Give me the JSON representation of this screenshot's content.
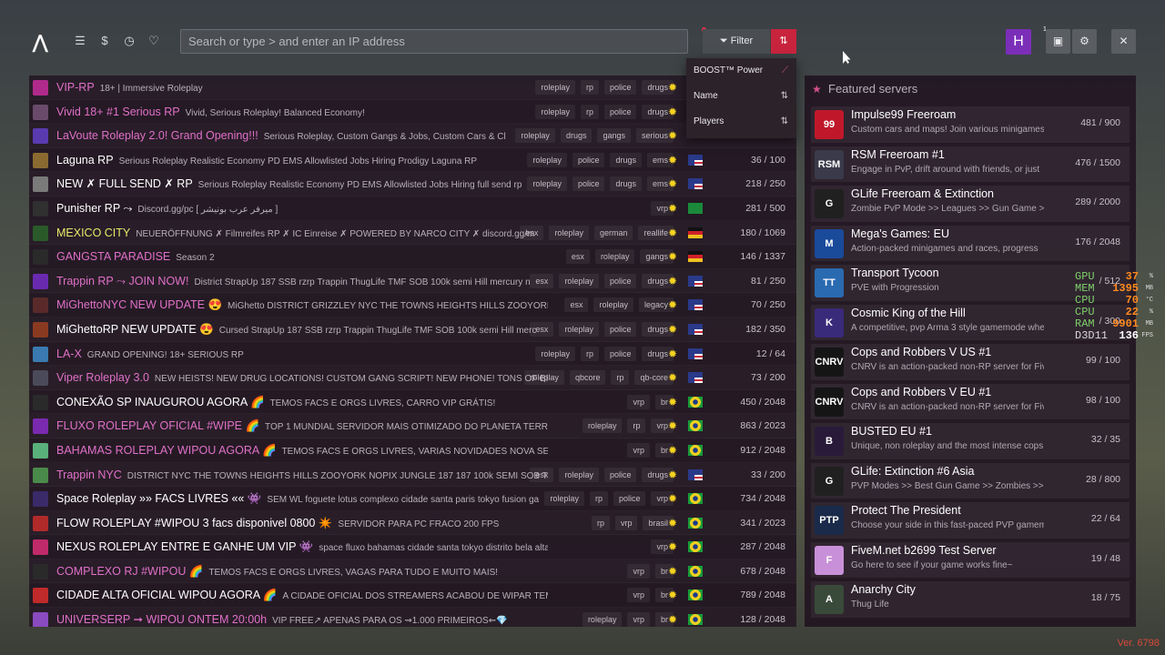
{
  "header": {
    "search_placeholder": "Search or type > and enter an IP address",
    "filter_label": "Filter",
    "avatar_letter": "H",
    "notif_count": "1"
  },
  "sort_menu": [
    {
      "label": "BOOST™ Power",
      "icon": "trend-icon"
    },
    {
      "label": "Name",
      "icon": "sort-az-icon"
    },
    {
      "label": "Players",
      "icon": "sort-num-icon"
    }
  ],
  "servers": [
    {
      "name": "VIP-RP",
      "color": "#e070c8",
      "desc": "18+ | Immersive Roleplay",
      "tags": [
        "roleplay",
        "rp",
        "police",
        "drugs"
      ],
      "flag": "",
      "players": "",
      "icon": "#b02a8c"
    },
    {
      "name": "Vivid 18+ #1 Serious RP",
      "color": "#e070c8",
      "desc": "Vivid, Serious Roleplay! Balanced Economy!",
      "tags": [
        "roleplay",
        "rp",
        "police",
        "drugs"
      ],
      "flag": "",
      "players": "",
      "icon": "#6a4a6a"
    },
    {
      "name": "LaVoute Roleplay 2.0! Grand Opening!!!",
      "color": "#e070c8",
      "desc": "Serious Roleplay, Custom Gangs & Jobs, Custom Cars & Cl",
      "tags": [
        "roleplay",
        "drugs",
        "gangs",
        "serious"
      ],
      "flag": "",
      "players": "",
      "icon": "#5a3ab0"
    },
    {
      "name": "Laguna RP",
      "color": "#ffffff",
      "desc": "Serious Roleplay Realistic Economy PD EMS Allowlisted Jobs Hiring Prodigy Laguna RP",
      "tags": [
        "roleplay",
        "police",
        "drugs",
        "ems"
      ],
      "flag": "us",
      "players": "36 / 100",
      "icon": "#8a6a30"
    },
    {
      "name": "NEW ✗ FULL SEND ✗ RP",
      "color": "#ffffff",
      "desc": "Serious Roleplay Realistic Economy PD EMS Allowlisted Jobs Hiring full send rp",
      "tags": [
        "roleplay",
        "police",
        "drugs",
        "ems"
      ],
      "flag": "us",
      "players": "218 / 250",
      "icon": "#7a7a7a"
    },
    {
      "name": "Punisher RP ⤳",
      "color": "#ffffff",
      "desc": "Discord.gg/pc [ ميرفر عرب بونيشر ]",
      "tags": [
        "vrp"
      ],
      "flag": "sa",
      "players": "281 / 500",
      "icon": "#303030"
    },
    {
      "name": "MEXICO CITY",
      "color": "#e8e86a",
      "desc": "NEUERÖFFNUNG ✗ Filmreifes RP ✗ IC Einreise ✗ POWERED BY NARCO CITY ✗ discord.gg/m",
      "tags": [
        "esx",
        "roleplay",
        "german",
        "reallife"
      ],
      "flag": "de",
      "players": "180 / 1069",
      "icon": "#2a5a2a"
    },
    {
      "name": "GANGSTA PARADISE",
      "color": "#e070c8",
      "desc": "Season 2",
      "tags": [
        "esx",
        "roleplay",
        "gangs"
      ],
      "flag": "de",
      "players": "146 / 1337",
      "icon": "#2a2a2a"
    },
    {
      "name": "Trappin RP ⤳ JOIN NOW!",
      "color": "#e070c8",
      "desc": "District StrapUp 187 SSB rzrp Trappin ThugLife TMF SOB 100k semi Hill mercury n",
      "tags": [
        "esx",
        "roleplay",
        "police",
        "drugs"
      ],
      "flag": "us",
      "players": "81 / 250",
      "icon": "#6a2ab0"
    },
    {
      "name": "MiGhettoNYC NEW UPDATE 😍",
      "color": "#e070c8",
      "desc": "MiGhetto DISTRICT GRIZZLEY NYC THE TOWNS HEIGHTS HILLS ZOOYORK NOPIX 3",
      "tags": [
        "esx",
        "roleplay",
        "legacy"
      ],
      "flag": "us",
      "players": "70 / 250",
      "icon": "#5a2a2a"
    },
    {
      "name": "MiGhettoRP NEW UPDATE 😍",
      "color": "#ffffff",
      "desc": "Cursed StrapUp 187 SSB rzrp Trappin ThugLife TMF SOB 100k semi Hill merc",
      "tags": [
        "esx",
        "roleplay",
        "police",
        "drugs"
      ],
      "flag": "us",
      "players": "182 / 350",
      "icon": "#8a3a20"
    },
    {
      "name": "LA-X",
      "color": "#e070c8",
      "desc": "GRAND OPENING! 18+ SERIOUS RP",
      "tags": [
        "roleplay",
        "rp",
        "police",
        "drugs"
      ],
      "flag": "us",
      "players": "12 / 64",
      "icon": "#3a7ab0"
    },
    {
      "name": "Viper Roleplay 3.0",
      "color": "#e070c8",
      "desc": "NEW HEISTS! NEW DRUG LOCATIONS! CUSTOM GANG SCRIPT! NEW PHONE! TONS OF BR",
      "tags": [
        "roleplay",
        "qbcore",
        "rp",
        "qb-core"
      ],
      "flag": "us",
      "players": "73 / 200",
      "icon": "#4a4a5a"
    },
    {
      "name": "CONEXÃO SP INAUGUROU AGORA 🌈",
      "color": "#ffffff",
      "desc": "TEMOS FACS E ORGS LIVRES, CARRO VIP GRÁTIS!",
      "tags": [
        "vrp",
        "br"
      ],
      "flag": "br",
      "players": "450 / 2048",
      "icon": "#2a2a2a"
    },
    {
      "name": "FLUXO ROLEPLAY OFICIAL #WIPE 🌈",
      "color": "#e070c8",
      "desc": "TOP 1 MUNDIAL SERVIDOR MAIS OTIMIZADO DO PLANETA TERRA",
      "tags": [
        "roleplay",
        "rp",
        "vrp"
      ],
      "flag": "br",
      "players": "863 / 2023",
      "icon": "#7a2ab0"
    },
    {
      "name": "BAHAMAS ROLEPLAY WIPOU AGORA 🌈",
      "color": "#e070c8",
      "desc": "TEMOS FACS E ORGS LIVRES, VARIAS NOVIDADES NOVA SEASON!",
      "tags": [
        "vrp",
        "br"
      ],
      "flag": "br",
      "players": "912 / 2048",
      "icon": "#5ab07a"
    },
    {
      "name": "Trappin NYC",
      "color": "#e070c8",
      "desc": "DISTRICT NYC THE TOWNS HEIGHTS HILLS ZOOYORK NOPIX JUNGLE 187 187 100k SEMI SOB TH",
      "tags": [
        "esx",
        "roleplay",
        "police",
        "drugs"
      ],
      "flag": "us",
      "players": "33 / 200",
      "icon": "#4a8a4a"
    },
    {
      "name": "Space Roleplay »» FACS LIVRES «« 👾",
      "color": "#ffffff",
      "desc": "SEM WL foguete lotus complexo cidade santa paris tokyo fusion ga",
      "tags": [
        "roleplay",
        "rp",
        "police",
        "vrp"
      ],
      "flag": "br",
      "players": "734 / 2048",
      "icon": "#3a2a6a"
    },
    {
      "name": "FLOW ROLEPLAY #WIPOU 3 facs disponivel 0800 ✴️",
      "color": "#ffffff",
      "desc": "SERVIDOR PARA PC FRACO 200 FPS",
      "tags": [
        "rp",
        "vrp",
        "brasil"
      ],
      "flag": "br",
      "players": "341 / 2023",
      "icon": "#b02a2a"
    },
    {
      "name": "NEXUS ROLEPLAY ENTRE E GANHE UM VIP 👾",
      "color": "#ffffff",
      "desc": "space fluxo bahamas cidade santa tokyo distrito bela alta complexo",
      "tags": [
        "vrp"
      ],
      "flag": "br",
      "players": "287 / 2048",
      "icon": "#c02a6a"
    },
    {
      "name": "COMPLEXO RJ #WIPOU 🌈",
      "color": "#e070c8",
      "desc": "TEMOS FACS E ORGS LIVRES, VAGAS PARA TUDO E MUITO MAIS!",
      "tags": [
        "vrp",
        "br"
      ],
      "flag": "br",
      "players": "678 / 2048",
      "icon": "#2a2a2a"
    },
    {
      "name": "CIDADE ALTA OFICIAL WIPOU AGORA 🌈",
      "color": "#ffffff",
      "desc": "A CIDADE OFICIAL DOS STREAMERS ACABOU DE WIPAR TEMOS FACS E ORGS LIVRE",
      "tags": [
        "vrp",
        "br"
      ],
      "flag": "br",
      "players": "789 / 2048",
      "icon": "#c02a2a"
    },
    {
      "name": "UNIVERSERP ➞ WIPOU ONTEM 20:00h",
      "color": "#e070c8",
      "desc": "VIP FREE↗ APENAS PARA OS ⇝1.000 PRIMEIROS⇜💎",
      "tags": [
        "roleplay",
        "vrp",
        "br"
      ],
      "flag": "br",
      "players": "128 / 2048",
      "icon": "#8a4ac0"
    }
  ],
  "featured": {
    "title": "Featured servers",
    "items": [
      {
        "name": "Impulse99 Freeroam",
        "desc": "Custom cars and maps! Join various minigames",
        "players": "481 / 900",
        "icon_text": "99",
        "icon_bg": "#c0182a"
      },
      {
        "name": "RSM Freeroam #1",
        "desc": "Engage in PvP, drift around with friends, or just",
        "players": "476 / 1500",
        "icon_text": "RSM",
        "icon_bg": "#3a3a4a"
      },
      {
        "name": "GLife Freeroam & Extinction",
        "desc": "Zombie PvP Mode >> Leagues >> Gun Game >>",
        "players": "289 / 2000",
        "icon_text": "G",
        "icon_bg": "#202020"
      },
      {
        "name": "Mega's Games: EU",
        "desc": "Action-packed minigames and races, progress",
        "players": "176 / 2048",
        "icon_text": "M",
        "icon_bg": "#1a4a9a"
      },
      {
        "name": "Transport Tycoon",
        "desc": "PVE with Progression",
        "players": "/ 512",
        "icon_text": "TT",
        "icon_bg": "#2a6ab0"
      },
      {
        "name": "Cosmic King of the Hill",
        "desc": "A competitive, pvp Arma 3 style gamemode whe",
        "players": "/ 300",
        "icon_text": "K",
        "icon_bg": "#3a2a7a"
      },
      {
        "name": "Cops and Robbers V US #1",
        "desc": "CNRV is an action-packed non-RP server for Five",
        "players": "99 / 100",
        "icon_text": "CNRV",
        "icon_bg": "#151515"
      },
      {
        "name": "Cops and Robbers V EU #1",
        "desc": "CNRV is an action-packed non-RP server for Five",
        "players": "98 / 100",
        "icon_text": "CNRV",
        "icon_bg": "#151515"
      },
      {
        "name": "BUSTED EU #1",
        "desc": "Unique, non roleplay and the most intense cops vs",
        "players": "32 / 35",
        "icon_text": "B",
        "icon_bg": "#2a1a3a"
      },
      {
        "name": "GLife: Extinction #6 Asia",
        "desc": "PVP Modes >> Best Gun Game >> Zombies >> Aird",
        "players": "28 / 800",
        "icon_text": "G",
        "icon_bg": "#202020"
      },
      {
        "name": "Protect The President",
        "desc": "Choose your side in this fast-paced PVP gamemod",
        "players": "22 / 64",
        "icon_text": "PTP",
        "icon_bg": "#1a2a4a"
      },
      {
        "name": "FiveM.net b2699 Test Server",
        "desc": "Go here to see if your game works fine~",
        "players": "19 / 48",
        "icon_text": "F",
        "icon_bg": "#c890d8"
      },
      {
        "name": "Anarchy City",
        "desc": "Thug Life",
        "players": "18 / 75",
        "icon_text": "A",
        "icon_bg": "#3a4a3a"
      }
    ]
  },
  "perf": [
    {
      "label": "GPU",
      "value": "37",
      "unit": "%"
    },
    {
      "label": "MEM",
      "value": "1395",
      "unit": "MB"
    },
    {
      "label": "CPU",
      "value": "70",
      "unit": "°C"
    },
    {
      "label": "CPU",
      "value": "22",
      "unit": "%"
    },
    {
      "label": "RAM",
      "value": "9901",
      "unit": "MB"
    },
    {
      "label": "D3D11",
      "value": "136",
      "unit": "FPS"
    }
  ],
  "version": "Ver. 6798"
}
